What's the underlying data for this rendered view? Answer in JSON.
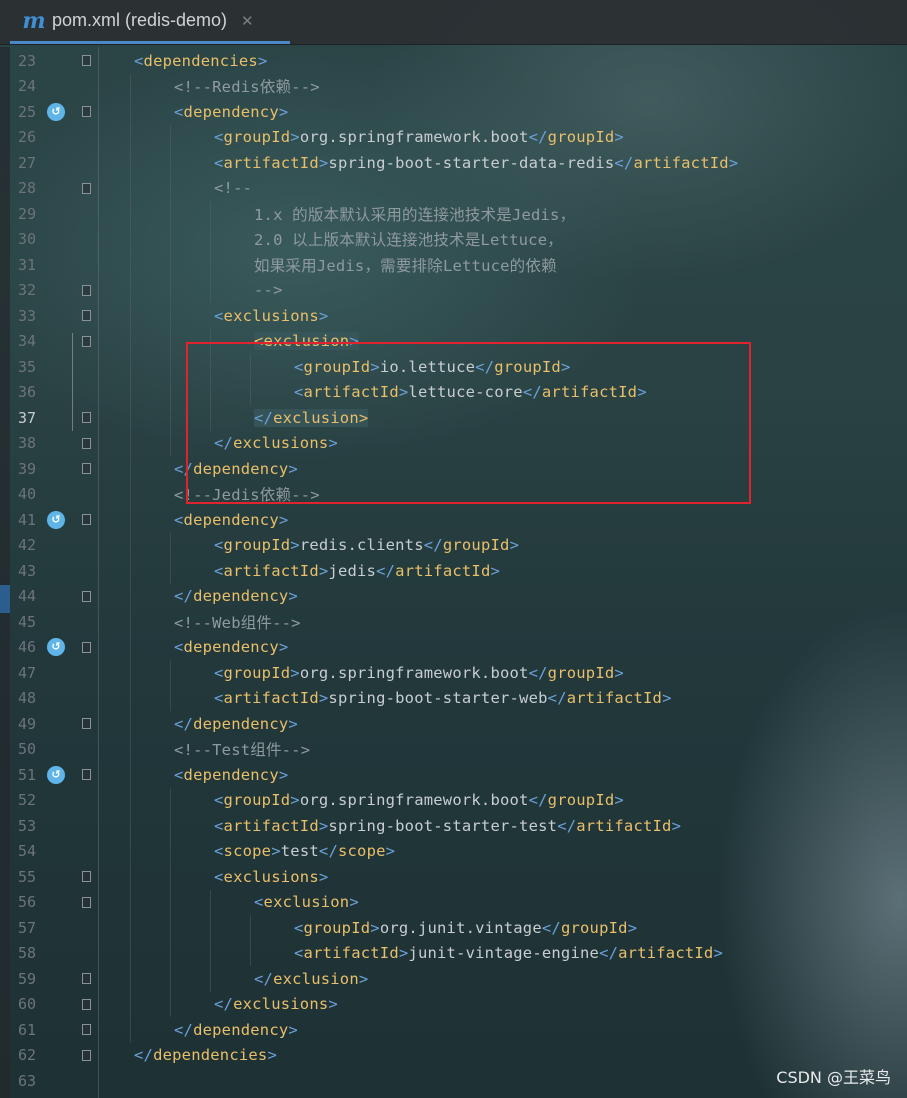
{
  "tab": {
    "icon": "m",
    "title": "pom.xml (redis-demo)",
    "close": "✕"
  },
  "editor": {
    "active_line": "37",
    "lines": [
      {
        "n": "23",
        "indent": 0,
        "fold": "▽",
        "parts": [
          [
            "b",
            "<"
          ],
          [
            "t",
            "dependencies"
          ],
          [
            "b",
            ">"
          ]
        ]
      },
      {
        "n": "24",
        "indent": 1,
        "parts": [
          [
            "cm",
            "<!--Redis依赖-->"
          ]
        ]
      },
      {
        "n": "25",
        "indent": 1,
        "run": true,
        "fold": "▽",
        "parts": [
          [
            "b",
            "<"
          ],
          [
            "t",
            "dependency"
          ],
          [
            "b",
            ">"
          ]
        ]
      },
      {
        "n": "26",
        "indent": 2,
        "parts": [
          [
            "b",
            "<"
          ],
          [
            "t",
            "groupId"
          ],
          [
            "b",
            ">"
          ],
          [
            "tx",
            "org.springframework.boot"
          ],
          [
            "b",
            "</"
          ],
          [
            "t",
            "groupId"
          ],
          [
            "b",
            ">"
          ]
        ]
      },
      {
        "n": "27",
        "indent": 2,
        "parts": [
          [
            "b",
            "<"
          ],
          [
            "t",
            "artifactId"
          ],
          [
            "b",
            ">"
          ],
          [
            "tx",
            "spring-boot-starter-data-redis"
          ],
          [
            "b",
            "</"
          ],
          [
            "t",
            "artifactId"
          ],
          [
            "b",
            ">"
          ]
        ]
      },
      {
        "n": "28",
        "indent": 2,
        "fold": "▽",
        "parts": [
          [
            "cm",
            "<!--"
          ]
        ]
      },
      {
        "n": "29",
        "indent": 3,
        "parts": [
          [
            "cm",
            "1.x 的版本默认采用的连接池技术是Jedis，"
          ]
        ]
      },
      {
        "n": "30",
        "indent": 3,
        "parts": [
          [
            "cm",
            "2.0 以上版本默认连接池技术是Lettuce，"
          ]
        ]
      },
      {
        "n": "31",
        "indent": 3,
        "parts": [
          [
            "cm",
            "如果采用Jedis，需要排除Lettuce的依赖"
          ]
        ]
      },
      {
        "n": "32",
        "indent": 3,
        "fold": "△",
        "parts": [
          [
            "cm",
            "-->"
          ]
        ]
      },
      {
        "n": "33",
        "indent": 2,
        "fold": "▽",
        "parts": [
          [
            "b",
            "<"
          ],
          [
            "t",
            "exclusions"
          ],
          [
            "b",
            ">"
          ]
        ]
      },
      {
        "n": "34",
        "indent": 3,
        "fold": "▽",
        "hl": true,
        "parts": [
          [
            "t",
            "<"
          ],
          [
            "t",
            "exclusion"
          ],
          [
            "b",
            ">"
          ]
        ]
      },
      {
        "n": "35",
        "indent": 4,
        "parts": [
          [
            "b",
            "<"
          ],
          [
            "t",
            "groupId"
          ],
          [
            "b",
            ">"
          ],
          [
            "tx",
            "io.lettuce"
          ],
          [
            "b",
            "</"
          ],
          [
            "t",
            "groupId"
          ],
          [
            "b",
            ">"
          ]
        ]
      },
      {
        "n": "36",
        "indent": 4,
        "parts": [
          [
            "b",
            "<"
          ],
          [
            "t",
            "artifactId"
          ],
          [
            "b",
            ">"
          ],
          [
            "tx",
            "lettuce-core"
          ],
          [
            "b",
            "</"
          ],
          [
            "t",
            "artifactId"
          ],
          [
            "b",
            ">"
          ]
        ]
      },
      {
        "n": "37",
        "indent": 3,
        "fold": "△",
        "hl": true,
        "parts": [
          [
            "b",
            "</"
          ],
          [
            "t",
            "exclusion"
          ],
          [
            "t",
            ">"
          ]
        ]
      },
      {
        "n": "38",
        "indent": 2,
        "fold": "△",
        "parts": [
          [
            "b",
            "</"
          ],
          [
            "t",
            "exclusions"
          ],
          [
            "b",
            ">"
          ]
        ]
      },
      {
        "n": "39",
        "indent": 1,
        "fold": "△",
        "parts": [
          [
            "b",
            "</"
          ],
          [
            "t",
            "dependency"
          ],
          [
            "b",
            ">"
          ]
        ]
      },
      {
        "n": "40",
        "indent": 1,
        "parts": [
          [
            "cm",
            "<!--Jedis依赖-->"
          ]
        ]
      },
      {
        "n": "41",
        "indent": 1,
        "run": true,
        "fold": "▽",
        "parts": [
          [
            "b",
            "<"
          ],
          [
            "t",
            "dependency"
          ],
          [
            "b",
            ">"
          ]
        ]
      },
      {
        "n": "42",
        "indent": 2,
        "parts": [
          [
            "b",
            "<"
          ],
          [
            "t",
            "groupId"
          ],
          [
            "b",
            ">"
          ],
          [
            "tx",
            "redis.clients"
          ],
          [
            "b",
            "</"
          ],
          [
            "t",
            "groupId"
          ],
          [
            "b",
            ">"
          ]
        ]
      },
      {
        "n": "43",
        "indent": 2,
        "parts": [
          [
            "b",
            "<"
          ],
          [
            "t",
            "artifactId"
          ],
          [
            "b",
            ">"
          ],
          [
            "tx",
            "jedis"
          ],
          [
            "b",
            "</"
          ],
          [
            "t",
            "artifactId"
          ],
          [
            "b",
            ">"
          ]
        ]
      },
      {
        "n": "44",
        "indent": 1,
        "fold": "△",
        "parts": [
          [
            "b",
            "</"
          ],
          [
            "t",
            "dependency"
          ],
          [
            "b",
            ">"
          ]
        ]
      },
      {
        "n": "45",
        "indent": 1,
        "parts": [
          [
            "cm",
            "<!--Web组件-->"
          ]
        ]
      },
      {
        "n": "46",
        "indent": 1,
        "run": true,
        "fold": "▽",
        "parts": [
          [
            "b",
            "<"
          ],
          [
            "t",
            "dependency"
          ],
          [
            "b",
            ">"
          ]
        ]
      },
      {
        "n": "47",
        "indent": 2,
        "parts": [
          [
            "b",
            "<"
          ],
          [
            "t",
            "groupId"
          ],
          [
            "b",
            ">"
          ],
          [
            "tx",
            "org.springframework.boot"
          ],
          [
            "b",
            "</"
          ],
          [
            "t",
            "groupId"
          ],
          [
            "b",
            ">"
          ]
        ]
      },
      {
        "n": "48",
        "indent": 2,
        "parts": [
          [
            "b",
            "<"
          ],
          [
            "t",
            "artifactId"
          ],
          [
            "b",
            ">"
          ],
          [
            "tx",
            "spring-boot-starter-web"
          ],
          [
            "b",
            "</"
          ],
          [
            "t",
            "artifactId"
          ],
          [
            "b",
            ">"
          ]
        ]
      },
      {
        "n": "49",
        "indent": 1,
        "fold": "△",
        "parts": [
          [
            "b",
            "</"
          ],
          [
            "t",
            "dependency"
          ],
          [
            "b",
            ">"
          ]
        ]
      },
      {
        "n": "50",
        "indent": 1,
        "parts": [
          [
            "cm",
            "<!--Test组件-->"
          ]
        ]
      },
      {
        "n": "51",
        "indent": 1,
        "run": true,
        "fold": "▽",
        "parts": [
          [
            "b",
            "<"
          ],
          [
            "t",
            "dependency"
          ],
          [
            "b",
            ">"
          ]
        ]
      },
      {
        "n": "52",
        "indent": 2,
        "parts": [
          [
            "b",
            "<"
          ],
          [
            "t",
            "groupId"
          ],
          [
            "b",
            ">"
          ],
          [
            "tx",
            "org.springframework.boot"
          ],
          [
            "b",
            "</"
          ],
          [
            "t",
            "groupId"
          ],
          [
            "b",
            ">"
          ]
        ]
      },
      {
        "n": "53",
        "indent": 2,
        "parts": [
          [
            "b",
            "<"
          ],
          [
            "t",
            "artifactId"
          ],
          [
            "b",
            ">"
          ],
          [
            "tx",
            "spring-boot-starter-test"
          ],
          [
            "b",
            "</"
          ],
          [
            "t",
            "artifactId"
          ],
          [
            "b",
            ">"
          ]
        ]
      },
      {
        "n": "54",
        "indent": 2,
        "parts": [
          [
            "b",
            "<"
          ],
          [
            "t",
            "scope"
          ],
          [
            "b",
            ">"
          ],
          [
            "tx",
            "test"
          ],
          [
            "b",
            "</"
          ],
          [
            "t",
            "scope"
          ],
          [
            "b",
            ">"
          ]
        ]
      },
      {
        "n": "55",
        "indent": 2,
        "fold": "▽",
        "parts": [
          [
            "b",
            "<"
          ],
          [
            "t",
            "exclusions"
          ],
          [
            "b",
            ">"
          ]
        ]
      },
      {
        "n": "56",
        "indent": 3,
        "fold": "▽",
        "parts": [
          [
            "b",
            "<"
          ],
          [
            "t",
            "exclusion"
          ],
          [
            "b",
            ">"
          ]
        ]
      },
      {
        "n": "57",
        "indent": 4,
        "parts": [
          [
            "b",
            "<"
          ],
          [
            "t",
            "groupId"
          ],
          [
            "b",
            ">"
          ],
          [
            "tx",
            "org.junit.vintage"
          ],
          [
            "b",
            "</"
          ],
          [
            "t",
            "groupId"
          ],
          [
            "b",
            ">"
          ]
        ]
      },
      {
        "n": "58",
        "indent": 4,
        "parts": [
          [
            "b",
            "<"
          ],
          [
            "t",
            "artifactId"
          ],
          [
            "b",
            ">"
          ],
          [
            "tx",
            "junit-vintage-engine"
          ],
          [
            "b",
            "</"
          ],
          [
            "t",
            "artifactId"
          ],
          [
            "b",
            ">"
          ]
        ]
      },
      {
        "n": "59",
        "indent": 3,
        "fold": "△",
        "parts": [
          [
            "b",
            "</"
          ],
          [
            "t",
            "exclusion"
          ],
          [
            "b",
            ">"
          ]
        ]
      },
      {
        "n": "60",
        "indent": 2,
        "fold": "△",
        "parts": [
          [
            "b",
            "</"
          ],
          [
            "t",
            "exclusions"
          ],
          [
            "b",
            ">"
          ]
        ]
      },
      {
        "n": "61",
        "indent": 1,
        "fold": "△",
        "parts": [
          [
            "b",
            "</"
          ],
          [
            "t",
            "dependency"
          ],
          [
            "b",
            ">"
          ]
        ]
      },
      {
        "n": "62",
        "indent": 0,
        "fold": "△",
        "parts": [
          [
            "b",
            "</"
          ],
          [
            "t",
            "dependencies"
          ],
          [
            "b",
            ">"
          ]
        ]
      },
      {
        "n": "63",
        "indent": 0,
        "parts": []
      }
    ]
  },
  "run_icon": "run-gutter-icon",
  "watermark": "CSDN @王菜鸟"
}
